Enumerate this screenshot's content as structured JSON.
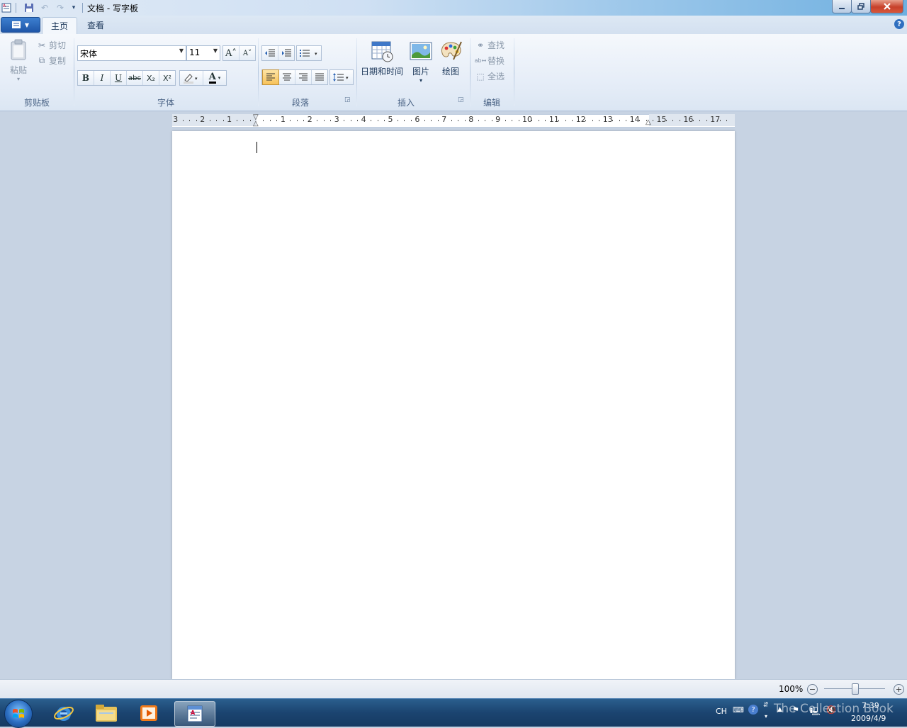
{
  "window": {
    "title": "文档 - 写字板"
  },
  "tabs": [
    {
      "label": "主页"
    },
    {
      "label": "查看"
    }
  ],
  "ribbon": {
    "clipboard": {
      "label": "剪贴板",
      "paste": "粘贴",
      "cut": "剪切",
      "copy": "复制"
    },
    "font": {
      "label": "字体",
      "family": "宋体",
      "size": "11",
      "bold": "B",
      "italic": "I",
      "underline": "U",
      "strike": "abc",
      "subscript": "X₂",
      "superscript": "X²",
      "color_a": "A"
    },
    "paragraph": {
      "label": "段落"
    },
    "insert": {
      "label": "插入",
      "datetime": "日期和时间",
      "picture": "图片",
      "paint": "绘图"
    },
    "editing": {
      "label": "编辑",
      "find": "查找",
      "replace": "替换",
      "select_all": "全选"
    }
  },
  "ruler": {
    "left_numbers": [
      "3",
      "2",
      "1"
    ],
    "right_numbers": [
      "1",
      "2",
      "3",
      "4",
      "5",
      "6",
      "7",
      "8",
      "9",
      "10",
      "11",
      "12",
      "13",
      "14",
      "15",
      "16",
      "17"
    ]
  },
  "statusbar": {
    "zoom": "100%"
  },
  "taskbar": {
    "lang": "CH",
    "time": "7:39",
    "date": "2009/4/9",
    "watermark": "The Collection Book"
  },
  "colors": {
    "accent": "#2f6fc0",
    "page": "#ffffff",
    "workspace": "#c7d3e3",
    "taskbar": "#1b4470"
  }
}
